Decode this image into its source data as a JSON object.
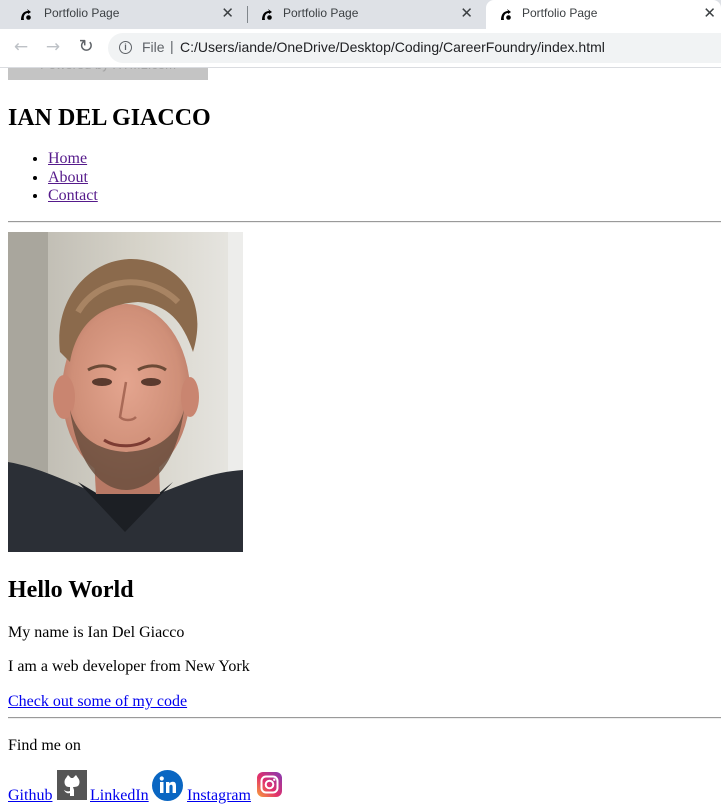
{
  "browser": {
    "tabs": [
      {
        "title": "Portfolio Page",
        "active": false
      },
      {
        "title": "Portfolio Page",
        "active": false
      },
      {
        "title": "Portfolio Page",
        "active": true
      }
    ],
    "close_glyph": "✕",
    "address_bar": {
      "scheme": "File",
      "separator": "|",
      "url": "C:/Users/iande/OneDrive/Desktop/Coding/CareerFoundry/index.html"
    },
    "icons": [
      "back-arrow-icon",
      "forward-arrow-icon",
      "reload-icon",
      "info-icon",
      "favicon-icon"
    ]
  },
  "page": {
    "banner_text": "Powered by HTML.com",
    "site_title": "IAN DEL GIACCO",
    "nav": [
      "Home",
      "About",
      "Contact"
    ],
    "heading": "Hello World",
    "intro": "My name is Ian Del Giacco",
    "bio": "I am a web developer from New York",
    "code_link": "Check out some of my code",
    "find_me": "Find me on",
    "social": [
      {
        "label": "Github",
        "icon": "github-icon"
      },
      {
        "label": "LinkedIn",
        "icon": "linkedin-icon"
      },
      {
        "label": "Instagram",
        "icon": "instagram-icon"
      }
    ]
  },
  "colors": {
    "tabbar_bg": "#dee1e6",
    "omnibox_bg": "#f1f3f4",
    "visited_link": "#551a8b",
    "link": "#0000ee",
    "linkedin_blue": "#0a66c2",
    "github_gray": "#555555"
  }
}
